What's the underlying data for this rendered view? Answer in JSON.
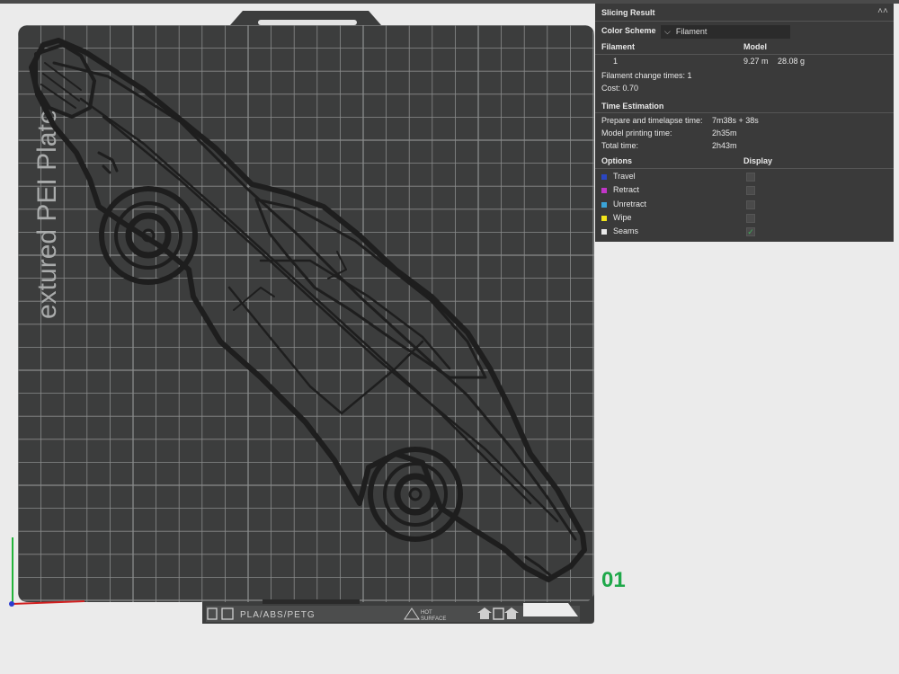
{
  "plate": {
    "watermark": "extured PEI Plate",
    "label_materials": "PLA/ABS/PETG",
    "label_hot_surface_line1": "HOT",
    "label_hot_surface_line2": "SURFACE",
    "plate_number": "01"
  },
  "slicing_result": {
    "title": "Slicing Result",
    "color_scheme_label": "Color Scheme",
    "color_scheme_value": "Filament",
    "filament_header": "Filament",
    "model_header": "Model",
    "filament_row": {
      "id": "1",
      "length": "9.27 m",
      "weight": "28.08 g"
    },
    "filament_change_times": "Filament change times:  1",
    "cost": "Cost:  0.70",
    "time_header": "Time Estimation",
    "time_rows": [
      {
        "label": "Prepare and timelapse time:",
        "value": "7m38s + 38s"
      },
      {
        "label": "Model printing time:",
        "value": "2h35m"
      },
      {
        "label": "Total time:",
        "value": "2h43m"
      }
    ],
    "options_header": "Options",
    "display_header": "Display",
    "options": [
      {
        "label": "Travel",
        "color": "#2b46c2",
        "display": false
      },
      {
        "label": "Retract",
        "color": "#c236c8",
        "display": false
      },
      {
        "label": "Unretract",
        "color": "#3aa4d8",
        "display": false
      },
      {
        "label": "Wipe",
        "color": "#f2e51a",
        "display": false
      },
      {
        "label": "Seams",
        "color": "#e8e8e8",
        "display": true
      }
    ]
  },
  "colors": {
    "plate": "#3c3d3d",
    "grid": "#8a8c8c",
    "model": "#1e1e1e",
    "background": "#ebebeb",
    "accent_green": "#1fa84a"
  }
}
